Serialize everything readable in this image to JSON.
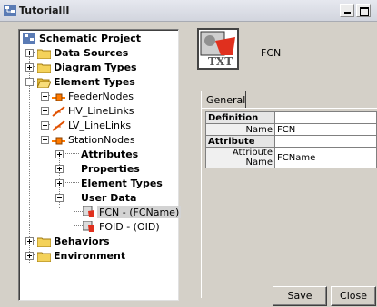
{
  "window": {
    "title": "TutorialII"
  },
  "tree": {
    "root": "Schematic Project",
    "data_sources": "Data Sources",
    "diagram_types": "Diagram Types",
    "element_types": "Element Types",
    "feeder_nodes": "FeederNodes",
    "hv_linelinks": "HV_LineLinks",
    "lv_linelinks": "LV_LineLinks",
    "station_nodes": "StationNodes",
    "attributes": "Attributes",
    "properties": "Properties",
    "sub_element_types": "Element Types",
    "user_data": "User Data",
    "fcn_item": "FCN - (FCName)",
    "foid_item": "FOID - (OID)",
    "behaviors": "Behaviors",
    "environment": "Environment"
  },
  "detail": {
    "name": "FCN",
    "tab_general": "General",
    "table": {
      "definition_header": "Definition",
      "name_key": "Name",
      "name_value": "FCN",
      "attribute_header": "Attribute",
      "attr_name_key": "Attribute Name",
      "attr_name_value": "FCName"
    }
  },
  "buttons": {
    "save": "Save",
    "close": "Close"
  },
  "colors": {
    "folder": "#f4d25a",
    "selected_bg": "#d3d3d3",
    "node_icon_orange": "#ff7a00"
  }
}
